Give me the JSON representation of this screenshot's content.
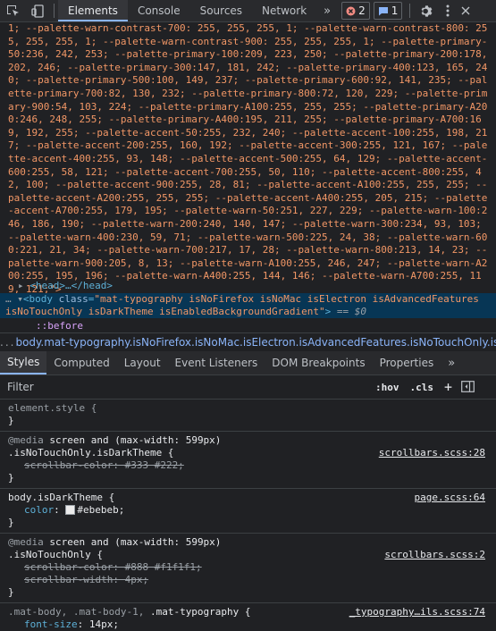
{
  "toolbar": {
    "tabs": [
      "Elements",
      "Console",
      "Sources",
      "Network"
    ],
    "more": "»",
    "errors_count": "2",
    "messages_count": "1"
  },
  "source": {
    "css_text": "1; --palette-warn-contrast-700: 255, 255, 255, 1; --palette-warn-contrast-800: 255, 255, 255, 1; --palette-warn-contrast-900: 255, 255, 255, 1; --palette-primary-50:236, 242, 253; --palette-primary-100:209, 223, 250; --palette-primary-200:178, 202, 246; --palette-primary-300:147, 181, 242; --palette-primary-400:123, 165, 240; --palette-primary-500:100, 149, 237; --palette-primary-600:92, 141, 235; --palette-primary-700:82, 130, 232; --palette-primary-800:72, 120, 229; --palette-primary-900:54, 103, 224; --palette-primary-A100:255, 255, 255; --palette-primary-A200:246, 248, 255; --palette-primary-A400:195, 211, 255; --palette-primary-A700:169, 192, 255; --palette-accent-50:255, 232, 240; --palette-accent-100:255, 198, 217; --palette-accent-200:255, 160, 192; --palette-accent-300:255, 121, 167; --palette-accent-400:255, 93, 148; --palette-accent-500:255, 64, 129; --palette-accent-600:255, 58, 121; --palette-accent-700:255, 50, 110; --palette-accent-800:255, 42, 100; --palette-accent-900:255, 28, 81; --palette-accent-A100:255, 255, 255; --palette-accent-A200:255, 255, 255; --palette-accent-A400:255, 205, 215; --palette-accent-A700:255, 179, 195; --palette-warn-50:251, 227, 229; --palette-warn-100:246, 186, 190; --palette-warn-200:240, 140, 147; --palette-warn-300:234, 93, 103; --palette-warn-400:230, 59, 71; --palette-warn-500:225, 24, 38; --palette-warn-600:221, 21, 34; --palette-warn-700:217, 17, 28; --palette-warn-800:213, 14, 23; --palette-warn-900:205, 8, 13; --palette-warn-A100:255, 246, 247; --palette-warn-A200:255, 195, 196; --palette-warn-A400:255, 144, 146; --palette-warn-A700:255, 119, 121;\">",
    "head_node": "<head>…</head>",
    "body_tag": "body",
    "body_class_attr": "class",
    "body_class_value": "\"mat-typography isNoFirefox isNoMac isElectron isAdvancedFeatures isNoTouchOnly isDarkTheme isEnabledBackgroundGradient\"",
    "body_eq": "== $0",
    "before": "::before"
  },
  "breadcrumb": {
    "dots": "...",
    "path": "body.mat-typography.isNoFirefox.isNoMac.isElectron.isAdvancedFeatures.isNoTouchOnly.is"
  },
  "styles_tabs": [
    "Styles",
    "Computed",
    "Layout",
    "Event Listeners",
    "DOM Breakpoints",
    "Properties"
  ],
  "filter": {
    "placeholder": "Filter",
    "hov": ":hov",
    "cls": ".cls",
    "plus": "+"
  },
  "rules": {
    "r1": {
      "selector": "element.style {",
      "close": "}"
    },
    "r2": {
      "media": "@media",
      "media_q": "screen and (max-width: 599px)",
      "selector": ".isNoTouchOnly.isDarkTheme {",
      "source": "scrollbars.scss:28",
      "p1": "scrollbar-color: #333 #222;",
      "close": "}"
    },
    "r3": {
      "selector": "body.isDarkTheme {",
      "source": "page.scss:64",
      "pname": "color",
      "pval": "#ebebeb;",
      "swatch": "#ebebeb",
      "close": "}"
    },
    "r4": {
      "media": "@media",
      "media_q": "screen and (max-width: 599px)",
      "selector": ".isNoTouchOnly {",
      "source": "scrollbars.scss:2",
      "p1": "scrollbar-color: #888 #f1f1f1;",
      "p2": "scrollbar-width: 4px;",
      "close": "}"
    },
    "r5": {
      "selector_dim": ".mat-body, .mat-body-1, ",
      "selector": ".mat-typography {",
      "source": "_typography…ils.scss:74",
      "pname": "font-size",
      "pval": "14px;"
    }
  }
}
